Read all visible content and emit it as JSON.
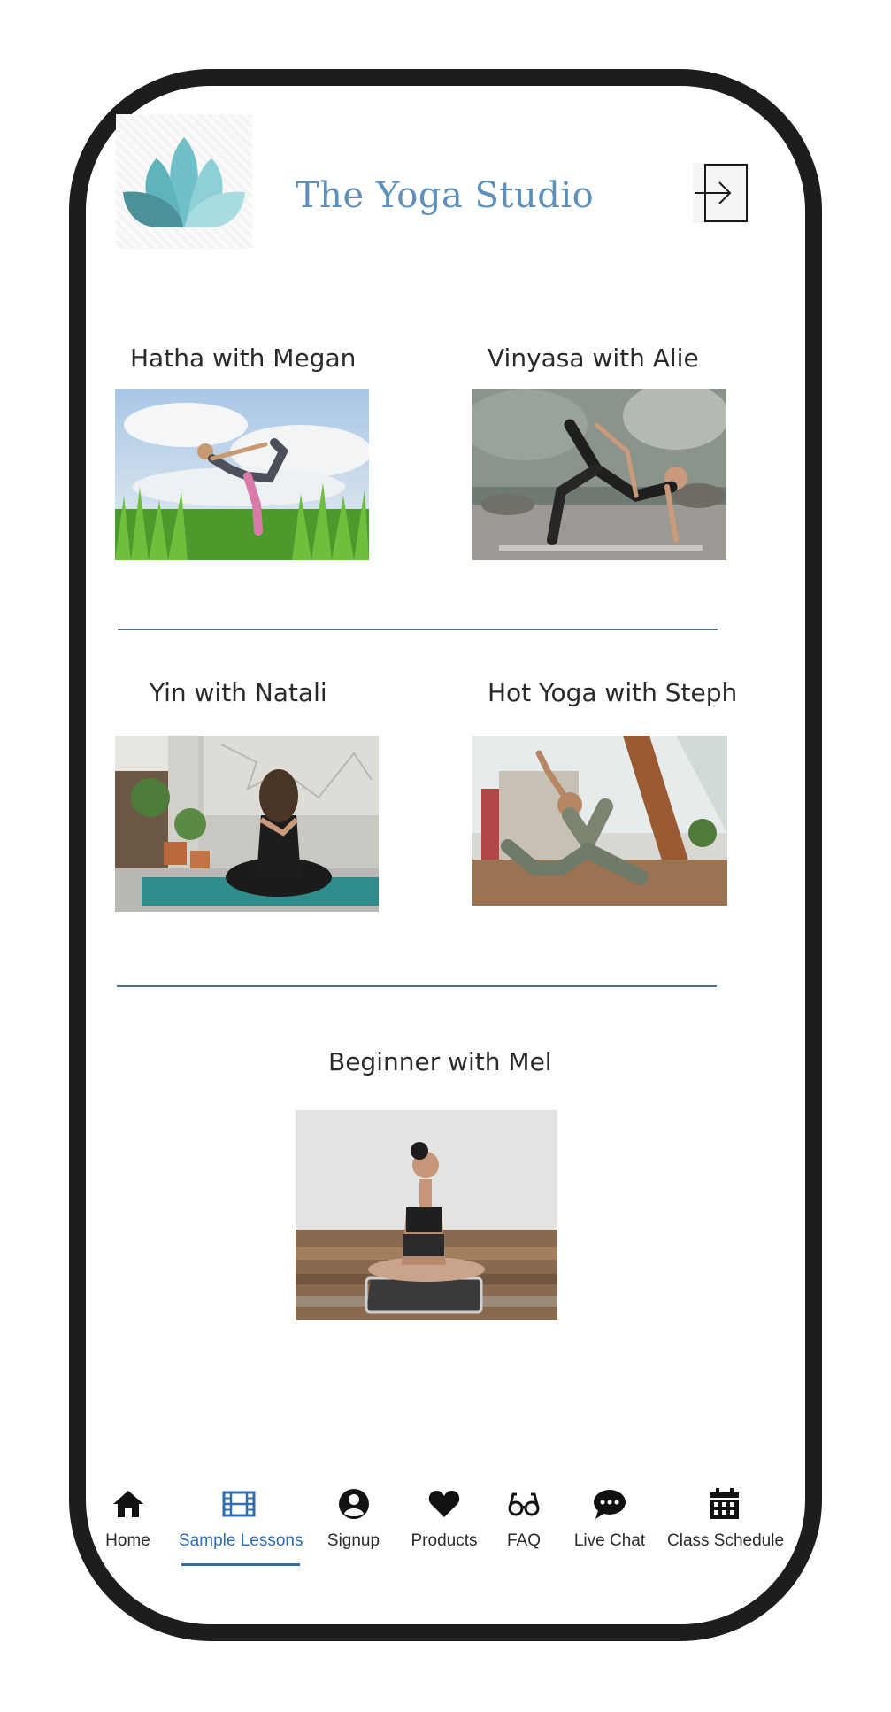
{
  "app": {
    "title": "The Yoga Studio"
  },
  "header": {
    "login_icon": "sign-in-icon",
    "logo_icon": "lotus-logo"
  },
  "lessons": [
    {
      "title": "Hatha with Megan"
    },
    {
      "title": "Vinyasa  with Alie"
    },
    {
      "title": "Yin with Natali"
    },
    {
      "title": "Hot Yoga with Steph"
    },
    {
      "title": "Beginner with Mel"
    }
  ],
  "nav": {
    "active": "Sample Lessons",
    "items": [
      {
        "label": "Home",
        "icon": "home-icon"
      },
      {
        "label": "Sample Lessons",
        "icon": "film-icon"
      },
      {
        "label": "Signup",
        "icon": "user-circle-icon"
      },
      {
        "label": "Products",
        "icon": "heart-icon"
      },
      {
        "label": "FAQ",
        "icon": "glasses-icon"
      },
      {
        "label": "Live Chat",
        "icon": "chat-bubble-icon"
      },
      {
        "label": "Class Schedule",
        "icon": "calendar-icon"
      }
    ]
  },
  "colors": {
    "brand": "#5e90ba",
    "accent": "#2f6db0",
    "divider": "#4f7196",
    "frame": "#1d1d1d",
    "lotus_light": "#8ccfd6",
    "lotus_dark": "#4f9aa3"
  }
}
